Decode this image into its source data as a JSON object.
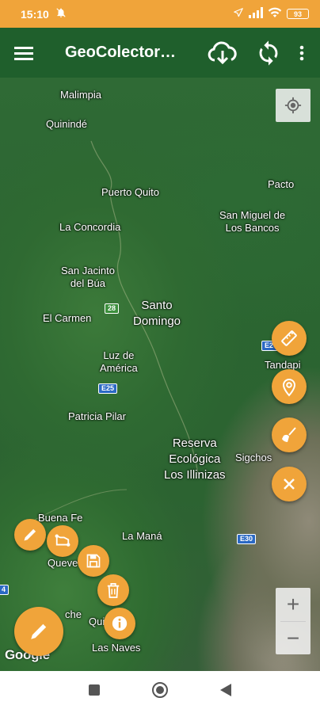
{
  "status_bar": {
    "time": "15:10",
    "battery": "93",
    "icons": [
      "bell-off-icon",
      "location-arrow-icon",
      "signal-icon",
      "wifi-icon",
      "battery-icon"
    ]
  },
  "app_bar": {
    "title": "GeoColector…",
    "icons": [
      "menu-icon",
      "cloud-download-icon",
      "sync-icon",
      "more-vert-icon"
    ]
  },
  "map": {
    "labels": {
      "malimpia": "Malimpia",
      "quininde": "Quinindé",
      "puerto_quito": "Puerto Quito",
      "pacto": "Pacto",
      "la_concordia": "La Concordia",
      "san_miguel_1": "San Miguel de",
      "san_miguel_2": "Los Bancos",
      "san_jacinto_1": "San Jacinto",
      "san_jacinto_2": "del Búa",
      "santo_1": "Santo",
      "santo_2": "Domingo",
      "el_carmen": "El Carmen",
      "luz_1": "Luz de",
      "luz_2": "América",
      "tandapi": "Tandapi",
      "patricia_pilar": "Patricia Pilar",
      "reserva_1": "Reserva",
      "reserva_2": "Ecológica",
      "reserva_3": "Los Illinizas",
      "sigchos": "Sigchos",
      "buena_fe": "Buena Fe",
      "la_mana": "La Maná",
      "quevedo": "Queve",
      "mocache": "che",
      "quinsaloma": "Qui       na",
      "las_naves": "Las Naves"
    },
    "road_shields": {
      "r28": "28",
      "e25": "E25",
      "e20": "E20",
      "e30": "E30",
      "r4": "4"
    },
    "attribution": "Google"
  },
  "tools_right": [
    "ruler-icon",
    "map-pin-icon",
    "broom-icon",
    "close-icon"
  ],
  "tools_left": [
    "pencil-icon",
    "polygon-icon",
    "save-icon",
    "trash-icon",
    "info-icon"
  ],
  "zoom": {
    "in": "+",
    "out": "−"
  },
  "accent_color": "#f0a43a",
  "appbar_color": "#1f5f2c"
}
